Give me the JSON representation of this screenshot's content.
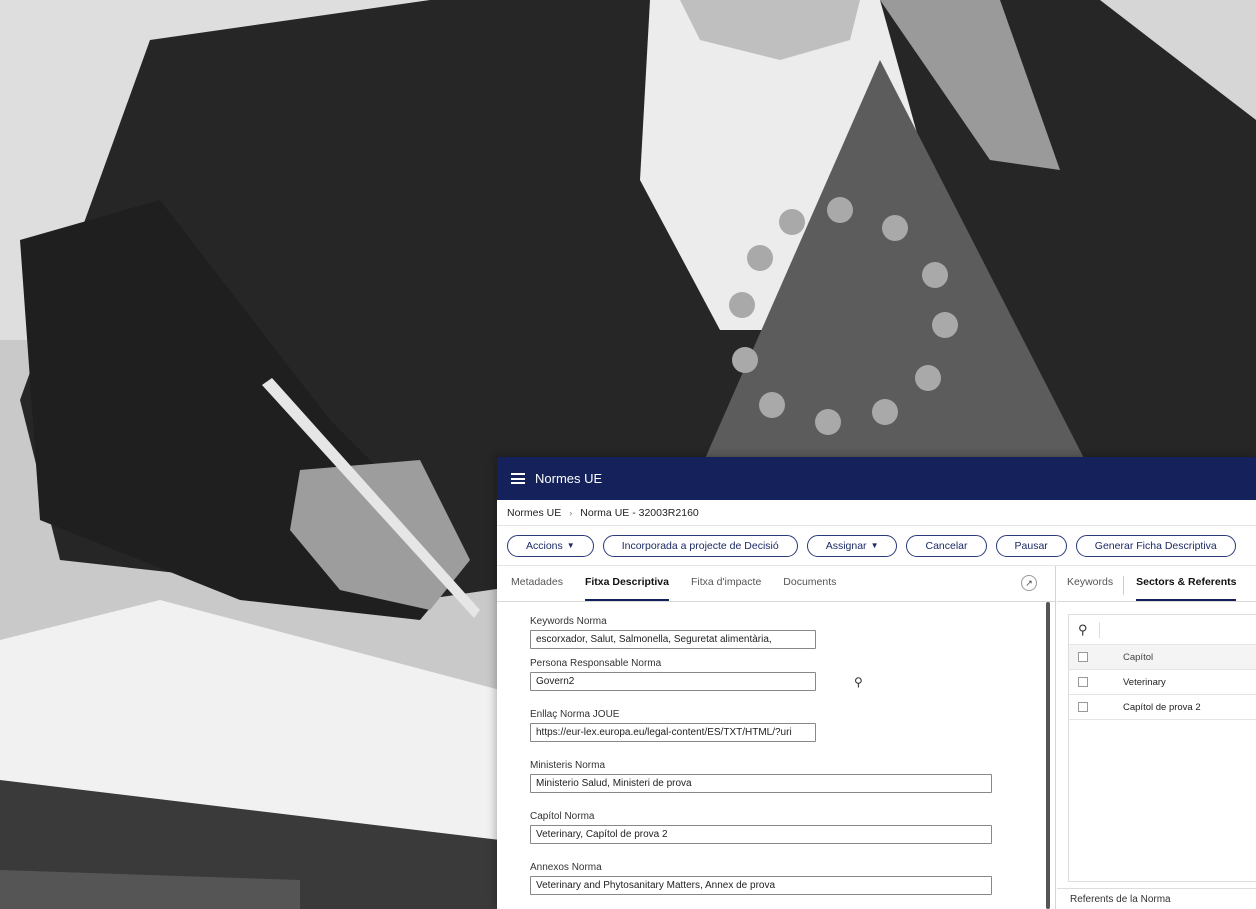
{
  "app": {
    "title": "Normes UE"
  },
  "breadcrumb": {
    "root": "Normes UE",
    "separator": "›",
    "current": "Norma UE - 32003R2160"
  },
  "toolbar": {
    "accions": "Accions",
    "incorporada": "Incorporada a projecte de Decisió",
    "assignar": "Assignar",
    "cancelar": "Cancelar",
    "pausar": "Pausar",
    "generar": "Generar Ficha Descriptiva"
  },
  "left_tabs": [
    "Metadades",
    "Fitxa Descriptiva",
    "Fitxa d'impacte",
    "Documents"
  ],
  "form": {
    "keywords": {
      "label": "Keywords Norma",
      "value": "escorxador, Salut, Salmonella, Seguretat alimentària,"
    },
    "responsable": {
      "label": "Persona Responsable Norma",
      "value": "Govern2"
    },
    "enllac": {
      "label": "Enllaç Norma JOUE",
      "value": "https://eur-lex.europa.eu/legal-content/ES/TXT/HTML/?uri"
    },
    "ministeris": {
      "label": "Ministeris Norma",
      "value": "Ministerio Salud, Ministeri de prova"
    },
    "capitol": {
      "label": "Capítol Norma",
      "value": "Veterinary, Capítol de prova 2"
    },
    "annexos": {
      "label": "Annexos Norma",
      "value": "Veterinary and Phytosanitary Matters, Annex de prova"
    }
  },
  "right_tabs": {
    "keywords": "Keywords",
    "sectors": "Sectors & Referents"
  },
  "grid": {
    "header": "Capítol",
    "rows": [
      "Veterinary",
      "Capítol de prova 2"
    ]
  },
  "referents": "Referents de la Norma",
  "colors": {
    "topbar": "#14215a",
    "accent": "#2b3a7a"
  },
  "icons": [
    "menu-icon",
    "chevron-down-icon",
    "expand-icon",
    "search-icon"
  ]
}
